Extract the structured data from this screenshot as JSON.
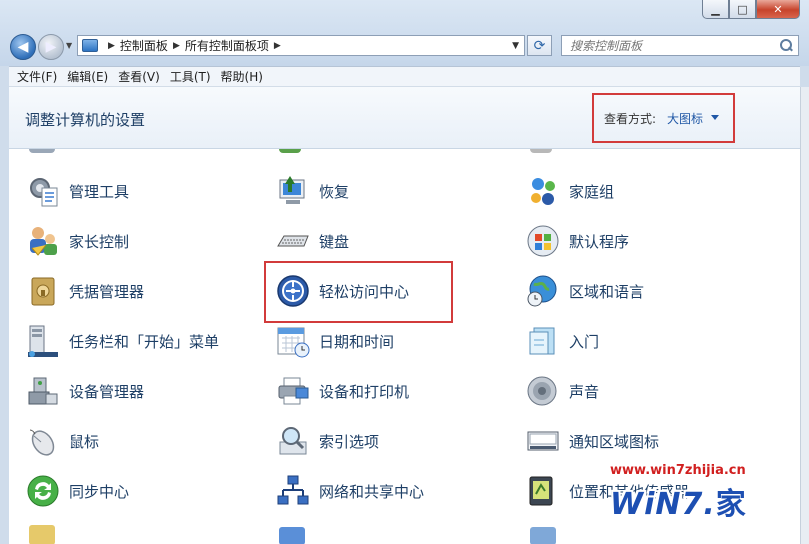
{
  "window": {
    "controls": {
      "minimize": "▁",
      "maximize": "□",
      "close": "✕"
    }
  },
  "nav": {
    "back": "◀",
    "forward": "▶",
    "breadcrumbs": [
      "控制面板",
      "所有控制面板项"
    ],
    "search_placeholder": "搜索控制面板"
  },
  "menu": [
    "文件(F)",
    "编辑(E)",
    "查看(V)",
    "工具(T)",
    "帮助(H)"
  ],
  "header": {
    "title": "调整计算机的设置",
    "view_label": "查看方式:",
    "view_value": "大图标"
  },
  "items": {
    "col1": [
      "管理工具",
      "家长控制",
      "凭据管理器",
      "任务栏和「开始」菜单",
      "设备管理器",
      "鼠标",
      "同步中心"
    ],
    "col2": [
      "恢复",
      "键盘",
      "轻松访问中心",
      "日期和时间",
      "设备和打印机",
      "索引选项",
      "网络和共享中心"
    ],
    "col3": [
      "家庭组",
      "默认程序",
      "区域和语言",
      "入门",
      "声音",
      "通知区域图标",
      "位置和其他传感器"
    ]
  },
  "watermark": {
    "url": "www.win7zhijia.cn",
    "logo": "WiN7.",
    "logo_char": "家"
  },
  "colors": {
    "link": "#1e3f66",
    "highlight": "#d23b3b",
    "accent": "#1f57a6"
  }
}
